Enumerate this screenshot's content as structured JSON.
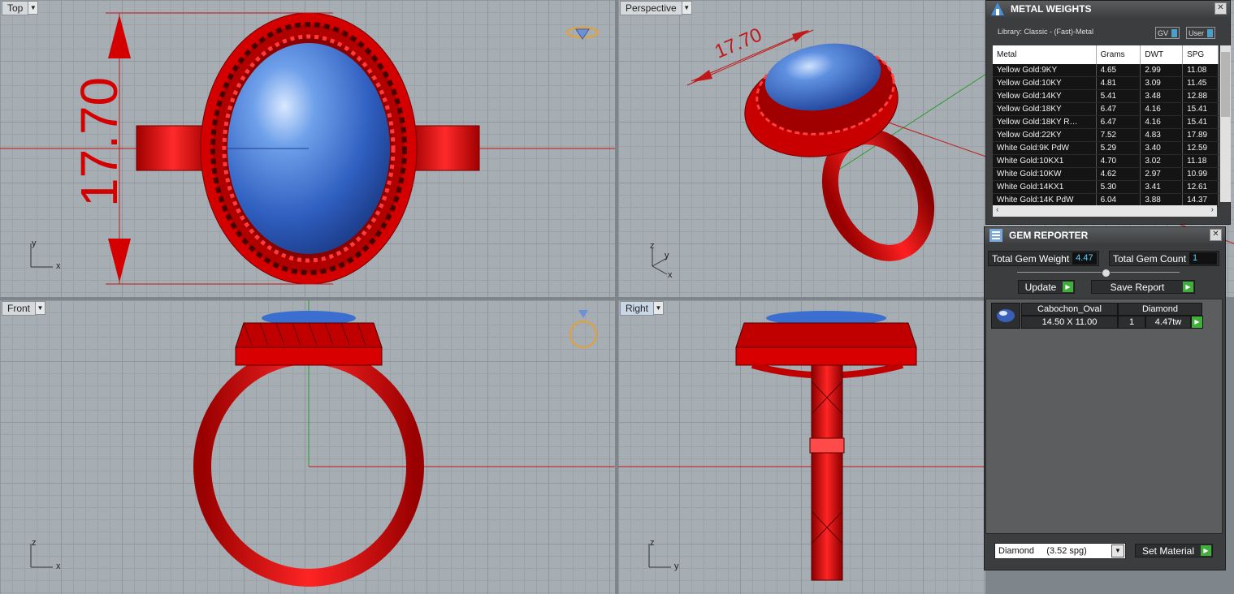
{
  "viewports": {
    "top": {
      "label": "Top",
      "dimension": "17.70",
      "axis_x": "x",
      "axis_y": "y"
    },
    "perspective": {
      "label": "Perspective",
      "dimension": "17.70",
      "axis_x": "x",
      "axis_y": "y",
      "axis_z": "z"
    },
    "front": {
      "label": "Front",
      "axis_x": "x",
      "axis_z": "z"
    },
    "right": {
      "label": "Right",
      "axis_y": "y",
      "axis_z": "z"
    }
  },
  "metal_weights": {
    "title": "METAL WEIGHTS",
    "library": "Library: Classic - (Fast)-Metal",
    "toggle_gv": "GV",
    "toggle_user": "User",
    "columns": [
      "Metal",
      "Grams",
      "DWT",
      "SPG"
    ],
    "rows": [
      [
        "Yellow Gold:9KY",
        "4.65",
        "2.99",
        "11.08"
      ],
      [
        "Yellow Gold:10KY",
        "4.81",
        "3.09",
        "11.45"
      ],
      [
        "Yellow Gold:14KY",
        "5.41",
        "3.48",
        "12.88"
      ],
      [
        "Yellow Gold:18KY",
        "6.47",
        "4.16",
        "15.41"
      ],
      [
        "Yellow Gold:18KY R…",
        "6.47",
        "4.16",
        "15.41"
      ],
      [
        "Yellow Gold:22KY",
        "7.52",
        "4.83",
        "17.89"
      ],
      [
        "White Gold:9K PdW",
        "5.29",
        "3.40",
        "12.59"
      ],
      [
        "White Gold:10KX1",
        "4.70",
        "3.02",
        "11.18"
      ],
      [
        "White Gold:10KW",
        "4.62",
        "2.97",
        "10.99"
      ],
      [
        "White Gold:14KX1",
        "5.30",
        "3.41",
        "12.61"
      ],
      [
        "White Gold:14K PdW",
        "6.04",
        "3.88",
        "14.37"
      ]
    ]
  },
  "gem_reporter": {
    "title": "GEM REPORTER",
    "total_weight_label": "Total Gem Weight",
    "total_weight_value": "4.47",
    "total_count_label": "Total Gem Count",
    "total_count_value": "1",
    "update_label": "Update",
    "save_report_label": "Save Report",
    "gem": {
      "shape": "Cabochon_Oval",
      "material": "Diamond",
      "size": "14.50 X 11.00",
      "qty": "1",
      "weight": "4.47tw"
    },
    "material_select": "Diamond     (3.52 spg)",
    "set_material_label": "Set Material"
  },
  "colors": {
    "metal": "#e01212",
    "stone": "#3a6fd0",
    "accent": "#5ad0ff",
    "go_button": "#3fae3a"
  }
}
